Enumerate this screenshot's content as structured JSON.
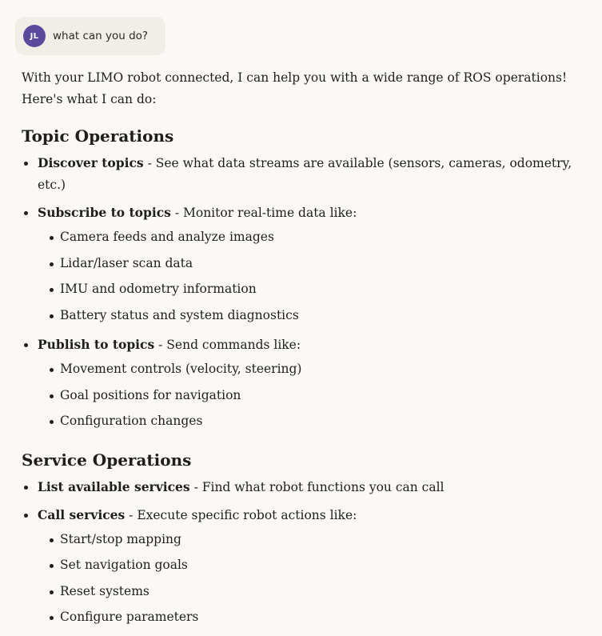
{
  "user_message": {
    "avatar_initials": "JL",
    "text": "what can you do?"
  },
  "response": {
    "intro": "With your LIMO robot connected, I can help you with a wide range of ROS operations! Here's what I can do:",
    "sections": [
      {
        "heading": "Topic Operations",
        "items": [
          {
            "title": "Discover topics",
            "desc": " - See what data streams are available (sensors, cameras, odometry, etc.)",
            "subitems": []
          },
          {
            "title": "Subscribe to topics",
            "desc": " - Monitor real-time data like:",
            "subitems": [
              "Camera feeds and analyze images",
              "Lidar/laser scan data",
              "IMU and odometry information",
              "Battery status and system diagnostics"
            ]
          },
          {
            "title": "Publish to topics",
            "desc": " - Send commands like:",
            "subitems": [
              "Movement controls (velocity, steering)",
              "Goal positions for navigation",
              "Configuration changes"
            ]
          }
        ]
      },
      {
        "heading": "Service Operations",
        "items": [
          {
            "title": "List available services",
            "desc": " - Find what robot functions you can call",
            "subitems": []
          },
          {
            "title": "Call services",
            "desc": " - Execute specific robot actions like:",
            "subitems": [
              "Start/stop mapping",
              "Set navigation goals",
              "Reset systems",
              "Configure parameters"
            ]
          }
        ]
      }
    ]
  }
}
